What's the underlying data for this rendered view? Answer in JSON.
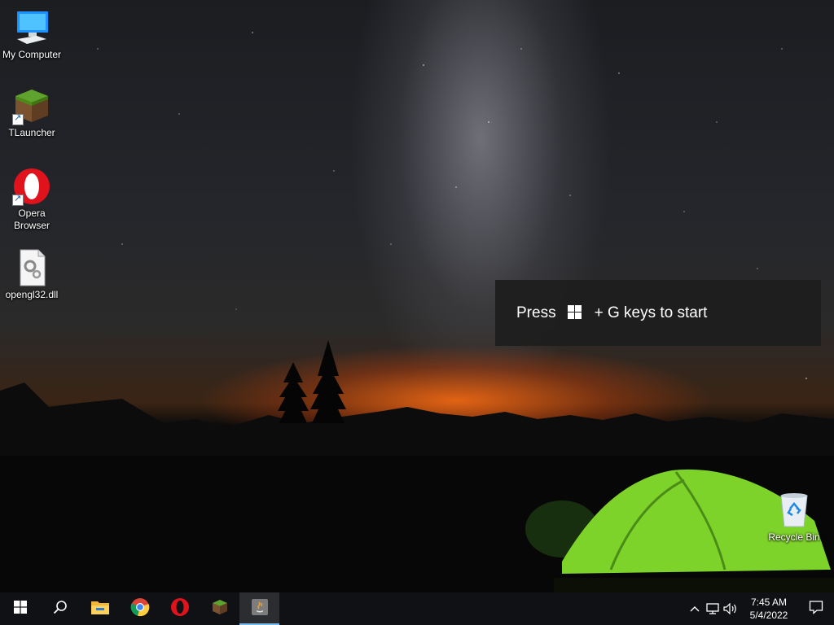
{
  "desktop": {
    "icons": [
      {
        "label": "My Computer",
        "icon": "computer-icon"
      },
      {
        "label": "TLauncher",
        "icon": "minecraft-grass-icon"
      },
      {
        "label": "Opera Browser",
        "icon": "opera-icon"
      },
      {
        "label": "opengl32.dll",
        "icon": "dll-file-icon"
      },
      {
        "label": "Recycle Bin",
        "icon": "recycle-bin-icon"
      }
    ]
  },
  "toast": {
    "prefix": "Press",
    "suffix": "+ G keys to start",
    "icon": "windows-logo-icon"
  },
  "taskbar": {
    "apps": [
      {
        "name": "start",
        "icon": "windows-logo-icon"
      },
      {
        "name": "search",
        "icon": "search-icon"
      },
      {
        "name": "file-explorer",
        "icon": "folder-icon"
      },
      {
        "name": "chrome",
        "icon": "chrome-icon"
      },
      {
        "name": "opera",
        "icon": "opera-icon"
      },
      {
        "name": "tlauncher",
        "icon": "minecraft-grass-icon"
      },
      {
        "name": "java",
        "icon": "java-icon",
        "active": true
      }
    ],
    "tray": {
      "icons": [
        "chevron-up-icon",
        "network-icon",
        "volume-icon"
      ],
      "time": "7:45 AM",
      "date": "5/4/2022",
      "notification_icon": "notification-icon"
    }
  },
  "colors": {
    "taskbar": "#101114",
    "toast_bg": "#1e1e1e",
    "active_indicator": "#76b9ed",
    "tent_green": "#7ed32a",
    "horizon_orange": "#ff6e14"
  }
}
